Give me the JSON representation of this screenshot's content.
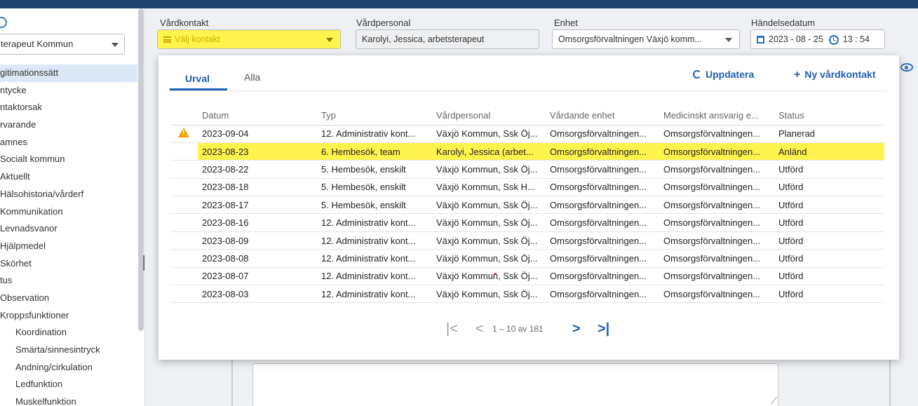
{
  "sidebar": {
    "role_select": "terapeut Kommun",
    "items": [
      "gitimationssätt",
      "ntycke",
      "ntaktorsak",
      "rvarande",
      "amnes",
      "Socialt kommun",
      "Aktuellt",
      "Hälsohistoria/vårderf",
      "Kommunikation",
      "Levnadsvanor",
      "Hjälpmedel",
      "Skörhet",
      "tus",
      "Observation",
      "Kroppsfunktioner"
    ],
    "sub_items": [
      "Koordination",
      "Smärta/sinnesintryck",
      "Andning/cirkulation",
      "Ledfunktion",
      "Muskelfunktion"
    ]
  },
  "header": {
    "vardkontakt_label": "Vårdkontakt",
    "vardkontakt_placeholder": "Välj kontakt",
    "vardpersonal_label": "Vårdpersonal",
    "vardpersonal_value": "Karolyi, Jessica, arbetsterapeut",
    "enhet_label": "Enhet",
    "enhet_value": "Omsorgsförvaltningen Växjö komm...",
    "datum_label": "Händelsedatum",
    "datum_value": "2023 - 08 - 25",
    "time_value": "13 : 54"
  },
  "popup": {
    "tabs": [
      "Urval",
      "Alla"
    ],
    "refresh_label": "Uppdatera",
    "new_contact_label": "Ny vårdkontakt",
    "columns": [
      "Datum",
      "Typ",
      "Vårdpersonal",
      "Vårdande enhet",
      "Medicinskt ansvarig e...",
      "Status"
    ],
    "rows": [
      [
        "2023-09-04",
        "12. Administrativ kont...",
        "Växjö Kommun, Ssk Öj...",
        "Omsorgsförvaltningen...",
        "Omsorgsförvaltningen...",
        "Planerad"
      ],
      [
        "2023-08-23",
        "6. Hembesök, team",
        "Karolyi, Jessica (arbet...",
        "Omsorgsförvaltningen...",
        "Omsorgsförvaltningen...",
        "Anländ"
      ],
      [
        "2023-08-22",
        "5. Hembesök, enskilt",
        "Växjö Kommun, Ssk Öj...",
        "Omsorgsförvaltningen...",
        "Omsorgsförvaltningen...",
        "Utförd"
      ],
      [
        "2023-08-18",
        "5. Hembesök, enskilt",
        "Växjö Kommun, Ssk H...",
        "Omsorgsförvaltningen...",
        "Omsorgsförvaltningen...",
        "Utförd"
      ],
      [
        "2023-08-17",
        "5. Hembesök, enskilt",
        "Växjö Kommun, Ssk Öj...",
        "Omsorgsförvaltningen...",
        "Omsorgsförvaltningen...",
        "Utförd"
      ],
      [
        "2023-08-16",
        "12. Administrativ kont...",
        "Växjö Kommun, Ssk Öj...",
        "Omsorgsförvaltningen...",
        "Omsorgsförvaltningen...",
        "Utförd"
      ],
      [
        "2023-08-09",
        "12. Administrativ kont...",
        "Växjö Kommun, Ssk Öj...",
        "Omsorgsförvaltningen...",
        "Omsorgsförvaltningen...",
        "Utförd"
      ],
      [
        "2023-08-08",
        "12. Administrativ kont...",
        "Växjö Kommun, Ssk Öj...",
        "Omsorgsförvaltningen...",
        "Omsorgsförvaltningen...",
        "Utförd"
      ],
      [
        "2023-08-07",
        "12. Administrativ kont...",
        "Växjö Kommun, Ssk Öj...",
        "Omsorgsförvaltningen...",
        "Omsorgsförvaltningen...",
        "Utförd"
      ],
      [
        "2023-08-03",
        "12. Administrativ kont...",
        "Växjö Kommun, Ssk Öj...",
        "Omsorgsförvaltningen...",
        "Omsorgsförvaltningen...",
        "Utförd"
      ]
    ],
    "pager": {
      "first": "|<",
      "prev": "<",
      "range": "1 – 10 av 181",
      "next": ">",
      "last": ">|"
    }
  },
  "colors": {
    "accent": "#1f5fb0",
    "highlight": "#fff34d",
    "warning": "#f0a000",
    "topbar": "#1f3f6e"
  },
  "icons": [
    "list-icon",
    "calendar-icon",
    "clock-icon",
    "refresh-icon",
    "plus-icon",
    "warning-icon",
    "eye-icon",
    "chevron-down-icon"
  ]
}
